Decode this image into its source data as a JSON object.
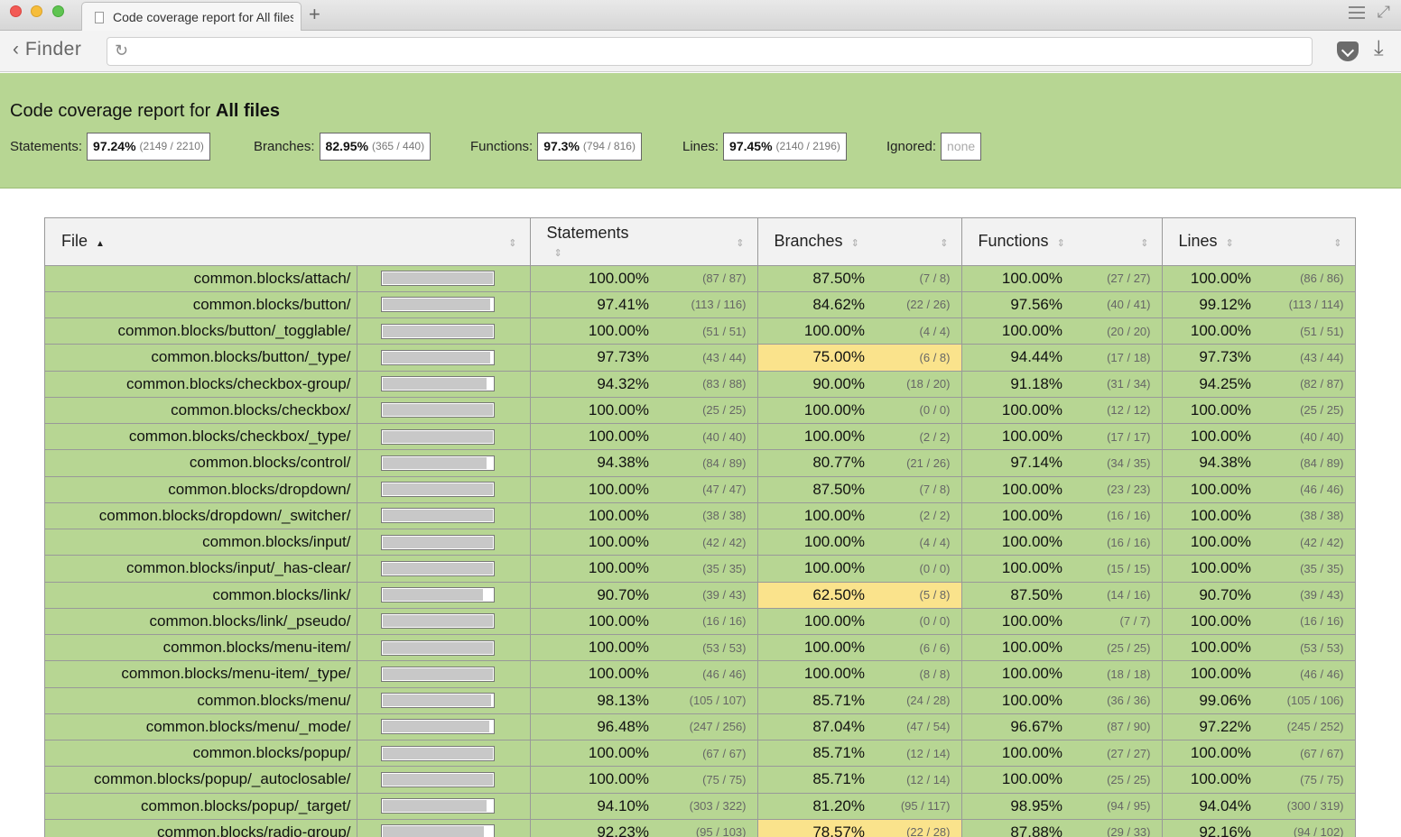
{
  "browser": {
    "tab_title": "Code coverage report for All files",
    "back_label": "Finder"
  },
  "header": {
    "title_prefix": "Code coverage report for",
    "title_strong": "All files",
    "summary": {
      "statements": {
        "label": "Statements:",
        "pct": "97.24%",
        "frac": "(2149 / 2210)"
      },
      "branches": {
        "label": "Branches:",
        "pct": "82.95%",
        "frac": "(365 / 440)"
      },
      "functions": {
        "label": "Functions:",
        "pct": "97.3%",
        "frac": "(794 / 816)"
      },
      "lines": {
        "label": "Lines:",
        "pct": "97.45%",
        "frac": "(2140 / 2196)"
      },
      "ignored": {
        "label": "Ignored:",
        "value": "none"
      }
    }
  },
  "table": {
    "columns": {
      "file": "File",
      "statements": "Statements",
      "branches": "Branches",
      "functions": "Functions",
      "lines": "Lines"
    },
    "rows": [
      {
        "file": "common.blocks/attach/",
        "bar": 1.0,
        "s_pct": "100.00%",
        "s_frac": "(87 / 87)",
        "b_pct": "87.50%",
        "b_frac": "(7 / 8)",
        "f_pct": "100.00%",
        "f_frac": "(27 / 27)",
        "l_pct": "100.00%",
        "l_frac": "(86 / 86)",
        "b_status": "high"
      },
      {
        "file": "common.blocks/button/",
        "bar": 0.974,
        "s_pct": "97.41%",
        "s_frac": "(113 / 116)",
        "b_pct": "84.62%",
        "b_frac": "(22 / 26)",
        "f_pct": "97.56%",
        "f_frac": "(40 / 41)",
        "l_pct": "99.12%",
        "l_frac": "(113 / 114)",
        "b_status": "high"
      },
      {
        "file": "common.blocks/button/_togglable/",
        "bar": 1.0,
        "s_pct": "100.00%",
        "s_frac": "(51 / 51)",
        "b_pct": "100.00%",
        "b_frac": "(4 / 4)",
        "f_pct": "100.00%",
        "f_frac": "(20 / 20)",
        "l_pct": "100.00%",
        "l_frac": "(51 / 51)",
        "b_status": "high"
      },
      {
        "file": "common.blocks/button/_type/",
        "bar": 0.977,
        "s_pct": "97.73%",
        "s_frac": "(43 / 44)",
        "b_pct": "75.00%",
        "b_frac": "(6 / 8)",
        "f_pct": "94.44%",
        "f_frac": "(17 / 18)",
        "l_pct": "97.73%",
        "l_frac": "(43 / 44)",
        "b_status": "medium"
      },
      {
        "file": "common.blocks/checkbox-group/",
        "bar": 0.943,
        "s_pct": "94.32%",
        "s_frac": "(83 / 88)",
        "b_pct": "90.00%",
        "b_frac": "(18 / 20)",
        "f_pct": "91.18%",
        "f_frac": "(31 / 34)",
        "l_pct": "94.25%",
        "l_frac": "(82 / 87)",
        "b_status": "high"
      },
      {
        "file": "common.blocks/checkbox/",
        "bar": 1.0,
        "s_pct": "100.00%",
        "s_frac": "(25 / 25)",
        "b_pct": "100.00%",
        "b_frac": "(0 / 0)",
        "f_pct": "100.00%",
        "f_frac": "(12 / 12)",
        "l_pct": "100.00%",
        "l_frac": "(25 / 25)",
        "b_status": "high"
      },
      {
        "file": "common.blocks/checkbox/_type/",
        "bar": 1.0,
        "s_pct": "100.00%",
        "s_frac": "(40 / 40)",
        "b_pct": "100.00%",
        "b_frac": "(2 / 2)",
        "f_pct": "100.00%",
        "f_frac": "(17 / 17)",
        "l_pct": "100.00%",
        "l_frac": "(40 / 40)",
        "b_status": "high"
      },
      {
        "file": "common.blocks/control/",
        "bar": 0.944,
        "s_pct": "94.38%",
        "s_frac": "(84 / 89)",
        "b_pct": "80.77%",
        "b_frac": "(21 / 26)",
        "f_pct": "97.14%",
        "f_frac": "(34 / 35)",
        "l_pct": "94.38%",
        "l_frac": "(84 / 89)",
        "b_status": "high"
      },
      {
        "file": "common.blocks/dropdown/",
        "bar": 1.0,
        "s_pct": "100.00%",
        "s_frac": "(47 / 47)",
        "b_pct": "87.50%",
        "b_frac": "(7 / 8)",
        "f_pct": "100.00%",
        "f_frac": "(23 / 23)",
        "l_pct": "100.00%",
        "l_frac": "(46 / 46)",
        "b_status": "high"
      },
      {
        "file": "common.blocks/dropdown/_switcher/",
        "bar": 1.0,
        "s_pct": "100.00%",
        "s_frac": "(38 / 38)",
        "b_pct": "100.00%",
        "b_frac": "(2 / 2)",
        "f_pct": "100.00%",
        "f_frac": "(16 / 16)",
        "l_pct": "100.00%",
        "l_frac": "(38 / 38)",
        "b_status": "high"
      },
      {
        "file": "common.blocks/input/",
        "bar": 1.0,
        "s_pct": "100.00%",
        "s_frac": "(42 / 42)",
        "b_pct": "100.00%",
        "b_frac": "(4 / 4)",
        "f_pct": "100.00%",
        "f_frac": "(16 / 16)",
        "l_pct": "100.00%",
        "l_frac": "(42 / 42)",
        "b_status": "high"
      },
      {
        "file": "common.blocks/input/_has-clear/",
        "bar": 1.0,
        "s_pct": "100.00%",
        "s_frac": "(35 / 35)",
        "b_pct": "100.00%",
        "b_frac": "(0 / 0)",
        "f_pct": "100.00%",
        "f_frac": "(15 / 15)",
        "l_pct": "100.00%",
        "l_frac": "(35 / 35)",
        "b_status": "high"
      },
      {
        "file": "common.blocks/link/",
        "bar": 0.907,
        "s_pct": "90.70%",
        "s_frac": "(39 / 43)",
        "b_pct": "62.50%",
        "b_frac": "(5 / 8)",
        "f_pct": "87.50%",
        "f_frac": "(14 / 16)",
        "l_pct": "90.70%",
        "l_frac": "(39 / 43)",
        "b_status": "medium"
      },
      {
        "file": "common.blocks/link/_pseudo/",
        "bar": 1.0,
        "s_pct": "100.00%",
        "s_frac": "(16 / 16)",
        "b_pct": "100.00%",
        "b_frac": "(0 / 0)",
        "f_pct": "100.00%",
        "f_frac": "(7 / 7)",
        "l_pct": "100.00%",
        "l_frac": "(16 / 16)",
        "b_status": "high"
      },
      {
        "file": "common.blocks/menu-item/",
        "bar": 1.0,
        "s_pct": "100.00%",
        "s_frac": "(53 / 53)",
        "b_pct": "100.00%",
        "b_frac": "(6 / 6)",
        "f_pct": "100.00%",
        "f_frac": "(25 / 25)",
        "l_pct": "100.00%",
        "l_frac": "(53 / 53)",
        "b_status": "high"
      },
      {
        "file": "common.blocks/menu-item/_type/",
        "bar": 1.0,
        "s_pct": "100.00%",
        "s_frac": "(46 / 46)",
        "b_pct": "100.00%",
        "b_frac": "(8 / 8)",
        "f_pct": "100.00%",
        "f_frac": "(18 / 18)",
        "l_pct": "100.00%",
        "l_frac": "(46 / 46)",
        "b_status": "high"
      },
      {
        "file": "common.blocks/menu/",
        "bar": 0.981,
        "s_pct": "98.13%",
        "s_frac": "(105 / 107)",
        "b_pct": "85.71%",
        "b_frac": "(24 / 28)",
        "f_pct": "100.00%",
        "f_frac": "(36 / 36)",
        "l_pct": "99.06%",
        "l_frac": "(105 / 106)",
        "b_status": "high"
      },
      {
        "file": "common.blocks/menu/_mode/",
        "bar": 0.965,
        "s_pct": "96.48%",
        "s_frac": "(247 / 256)",
        "b_pct": "87.04%",
        "b_frac": "(47 / 54)",
        "f_pct": "96.67%",
        "f_frac": "(87 / 90)",
        "l_pct": "97.22%",
        "l_frac": "(245 / 252)",
        "b_status": "high"
      },
      {
        "file": "common.blocks/popup/",
        "bar": 1.0,
        "s_pct": "100.00%",
        "s_frac": "(67 / 67)",
        "b_pct": "85.71%",
        "b_frac": "(12 / 14)",
        "f_pct": "100.00%",
        "f_frac": "(27 / 27)",
        "l_pct": "100.00%",
        "l_frac": "(67 / 67)",
        "b_status": "high"
      },
      {
        "file": "common.blocks/popup/_autoclosable/",
        "bar": 1.0,
        "s_pct": "100.00%",
        "s_frac": "(75 / 75)",
        "b_pct": "85.71%",
        "b_frac": "(12 / 14)",
        "f_pct": "100.00%",
        "f_frac": "(25 / 25)",
        "l_pct": "100.00%",
        "l_frac": "(75 / 75)",
        "b_status": "high"
      },
      {
        "file": "common.blocks/popup/_target/",
        "bar": 0.941,
        "s_pct": "94.10%",
        "s_frac": "(303 / 322)",
        "b_pct": "81.20%",
        "b_frac": "(95 / 117)",
        "f_pct": "98.95%",
        "f_frac": "(94 / 95)",
        "l_pct": "94.04%",
        "l_frac": "(300 / 319)",
        "b_status": "high"
      },
      {
        "file": "common.blocks/radio-group/",
        "bar": 0.922,
        "s_pct": "92.23%",
        "s_frac": "(95 / 103)",
        "b_pct": "78.57%",
        "b_frac": "(22 / 28)",
        "f_pct": "87.88%",
        "f_frac": "(29 / 33)",
        "l_pct": "92.16%",
        "l_frac": "(94 / 102)",
        "b_status": "medium"
      }
    ]
  }
}
